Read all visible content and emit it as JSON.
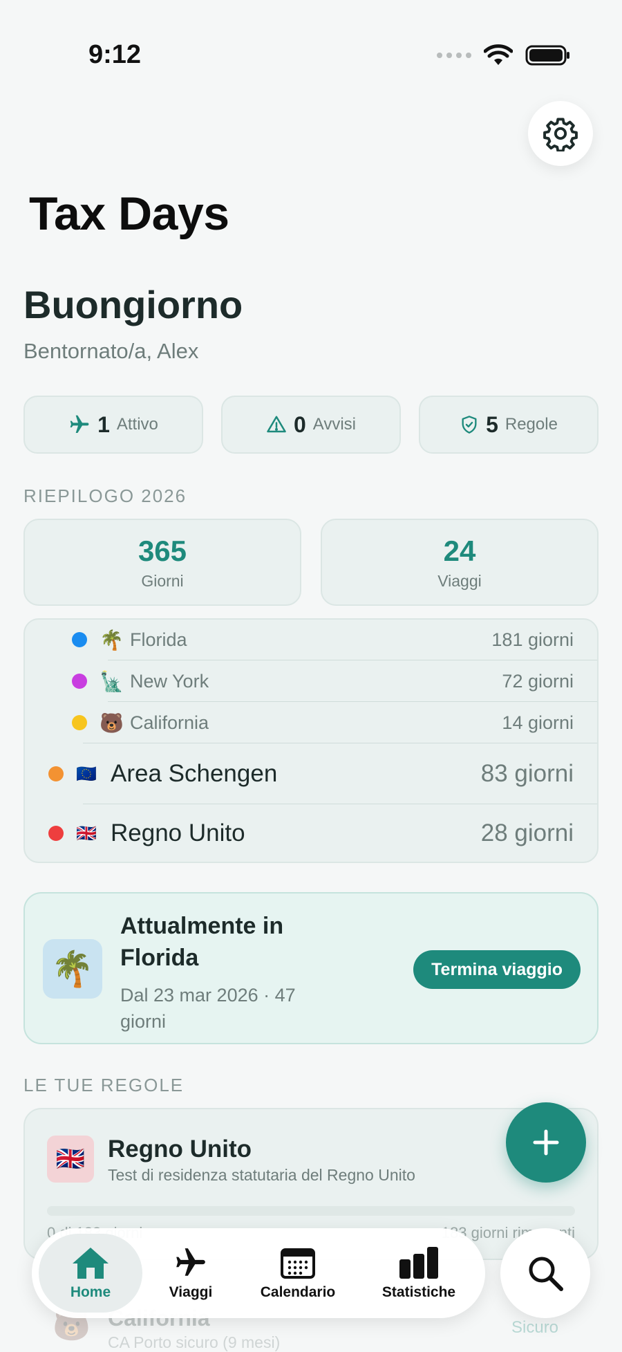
{
  "status_bar": {
    "time": "9:12"
  },
  "app_title": "Tax Days",
  "greeting": {
    "title": "Buongiorno",
    "subtitle": "Bentornato/a, Alex"
  },
  "chips": [
    {
      "icon": "airplane-icon",
      "value": "1",
      "label": "Attivo"
    },
    {
      "icon": "warning-icon",
      "value": "0",
      "label": "Avvisi"
    },
    {
      "icon": "shield-check-icon",
      "value": "5",
      "label": "Regole"
    }
  ],
  "summary": {
    "section_label": "RIEPILOGO 2026",
    "days": {
      "value": "365",
      "label": "Giorni"
    },
    "trips": {
      "value": "24",
      "label": "Viaggi"
    },
    "regions": [
      {
        "name": "Florida",
        "emoji": "🌴",
        "days": "181 giorni",
        "color": "#1a8cf0",
        "level": "sub"
      },
      {
        "name": "New York",
        "emoji": "🗽",
        "days": "72 giorni",
        "color": "#c83ee0",
        "level": "sub"
      },
      {
        "name": "California",
        "emoji": "🐻",
        "days": "14 giorni",
        "color": "#f7c51e",
        "level": "sub"
      },
      {
        "name": "Area Schengen",
        "emoji": "🇪🇺",
        "days": "83 giorni",
        "color": "#f39232",
        "level": "main"
      },
      {
        "name": "Regno Unito",
        "emoji": "🇬🇧",
        "days": "28 giorni",
        "color": "#ee3e3e",
        "level": "main"
      }
    ]
  },
  "current_trip": {
    "icon": "🌴",
    "title": "Attualmente in Florida",
    "subtitle": "Dal 23 mar 2026 · 47 giorni",
    "button": "Termina viaggio"
  },
  "rules": {
    "section_label": "LE TUE REGOLE",
    "items": [
      {
        "flag": "🇬🇧",
        "name": "Regno Unito",
        "description": "Test di residenza statutaria del Regno Unito",
        "foot_left": "0 di 183 giorni",
        "foot_right": "183 giorni rimanenti"
      }
    ],
    "background_item": {
      "icon": "🐻",
      "name": "California",
      "description": "CA Porto sicuro (9 mesi)",
      "status": "Sicuro"
    }
  },
  "tabs": [
    {
      "label": "Home",
      "icon": "home-icon",
      "active": true
    },
    {
      "label": "Viaggi",
      "icon": "airplane-icon",
      "active": false
    },
    {
      "label": "Calendario",
      "icon": "calendar-icon",
      "active": false
    },
    {
      "label": "Statistiche",
      "icon": "bar-chart-icon",
      "active": false
    }
  ],
  "colors": {
    "accent": "#1e8a7c",
    "background": "#f5f7f7"
  }
}
